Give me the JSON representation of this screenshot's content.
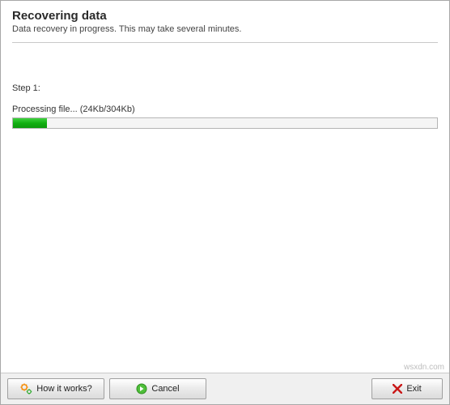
{
  "header": {
    "title": "Recovering data",
    "subtitle": "Data recovery in progress. This may take several minutes."
  },
  "progress": {
    "step_label": "Step 1:",
    "processing_label": "Processing file... (24Kb/304Kb)",
    "percent": 8
  },
  "footer": {
    "how_label": "How it works?",
    "cancel_label": "Cancel",
    "exit_label": "Exit"
  },
  "watermark": "wsxdn.com",
  "colors": {
    "progress_fill": "#12b012",
    "accent_orange": "#f58a00",
    "accent_green": "#2aa82a",
    "accent_red": "#c91818"
  }
}
